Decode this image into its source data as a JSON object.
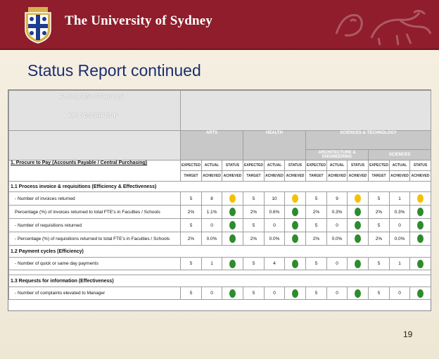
{
  "header": {
    "university_name": "The University of Sydney"
  },
  "page": {
    "title": "Status Report continued",
    "number": "19"
  },
  "colors": {
    "green": "#2e8b2e",
    "amber": "#f2c200",
    "maroon": "#8f1d2b"
  },
  "report": {
    "header_labels": {
      "faculties": "FACULTIES / SCHOOLS",
      "kpi": "KPI DESCRIPTION"
    },
    "faculties": [
      "ARTS",
      "HEALTH",
      "SCIENCES & TECHNOLOGY"
    ],
    "subfaculties": [
      "ARCHITECTURE & ENGINEERING",
      "SCIENCES"
    ],
    "section1": {
      "title": "1. Procure to Pay (Accounts Payable / Central Purchasing)"
    },
    "col_labels": {
      "expected": "EXPECTED",
      "actual": "ACTUAL",
      "status": "STATUS",
      "target": "TARGET",
      "achieved": "ACHIEVED"
    },
    "sub11": "1.1 Process invoice & requisitions (Efficiency & Effectiveness)",
    "sub12": "1.2 Payment cycles (Efficiency)",
    "sub13": "1.3 Requests for information (Effectiveness)",
    "rows": [
      {
        "label": "- Number of invoices returned",
        "cells": [
          "5",
          "8",
          "amber",
          "5",
          "10",
          "amber",
          "5",
          "9",
          "amber",
          "5",
          "1",
          "amber"
        ]
      },
      {
        "label": "Percentage (%) of invoices returned to total FTE's in Faculties / Schools",
        "cells": [
          "2%",
          "1.1%",
          "green",
          "2%",
          "0.6%",
          "green",
          "2%",
          "0.3%",
          "green",
          "2%",
          "0.3%",
          "green"
        ]
      },
      {
        "label": "- Number of requisitions returned",
        "cells": [
          "5",
          "0",
          "green",
          "5",
          "0",
          "green",
          "5",
          "0",
          "green",
          "5",
          "0",
          "green"
        ]
      },
      {
        "label": "- Percentage (%) of requisitions returned to total FTE's in Faculties / Schools",
        "cells": [
          "2%",
          "0.0%",
          "green",
          "2%",
          "0.0%",
          "green",
          "2%",
          "0.0%",
          "green",
          "2%",
          "0.0%",
          "green"
        ]
      },
      {
        "label": "- Number of quick or same day payments",
        "cells": [
          "5",
          "1",
          "green",
          "5",
          "4",
          "green",
          "5",
          "0",
          "green",
          "5",
          "1",
          "green"
        ]
      },
      {
        "label": "- Number of complaints elevated to Manager",
        "cells": [
          "5",
          "0",
          "green",
          "5",
          "0",
          "green",
          "5",
          "0",
          "green",
          "5",
          "0",
          "green"
        ]
      }
    ]
  }
}
